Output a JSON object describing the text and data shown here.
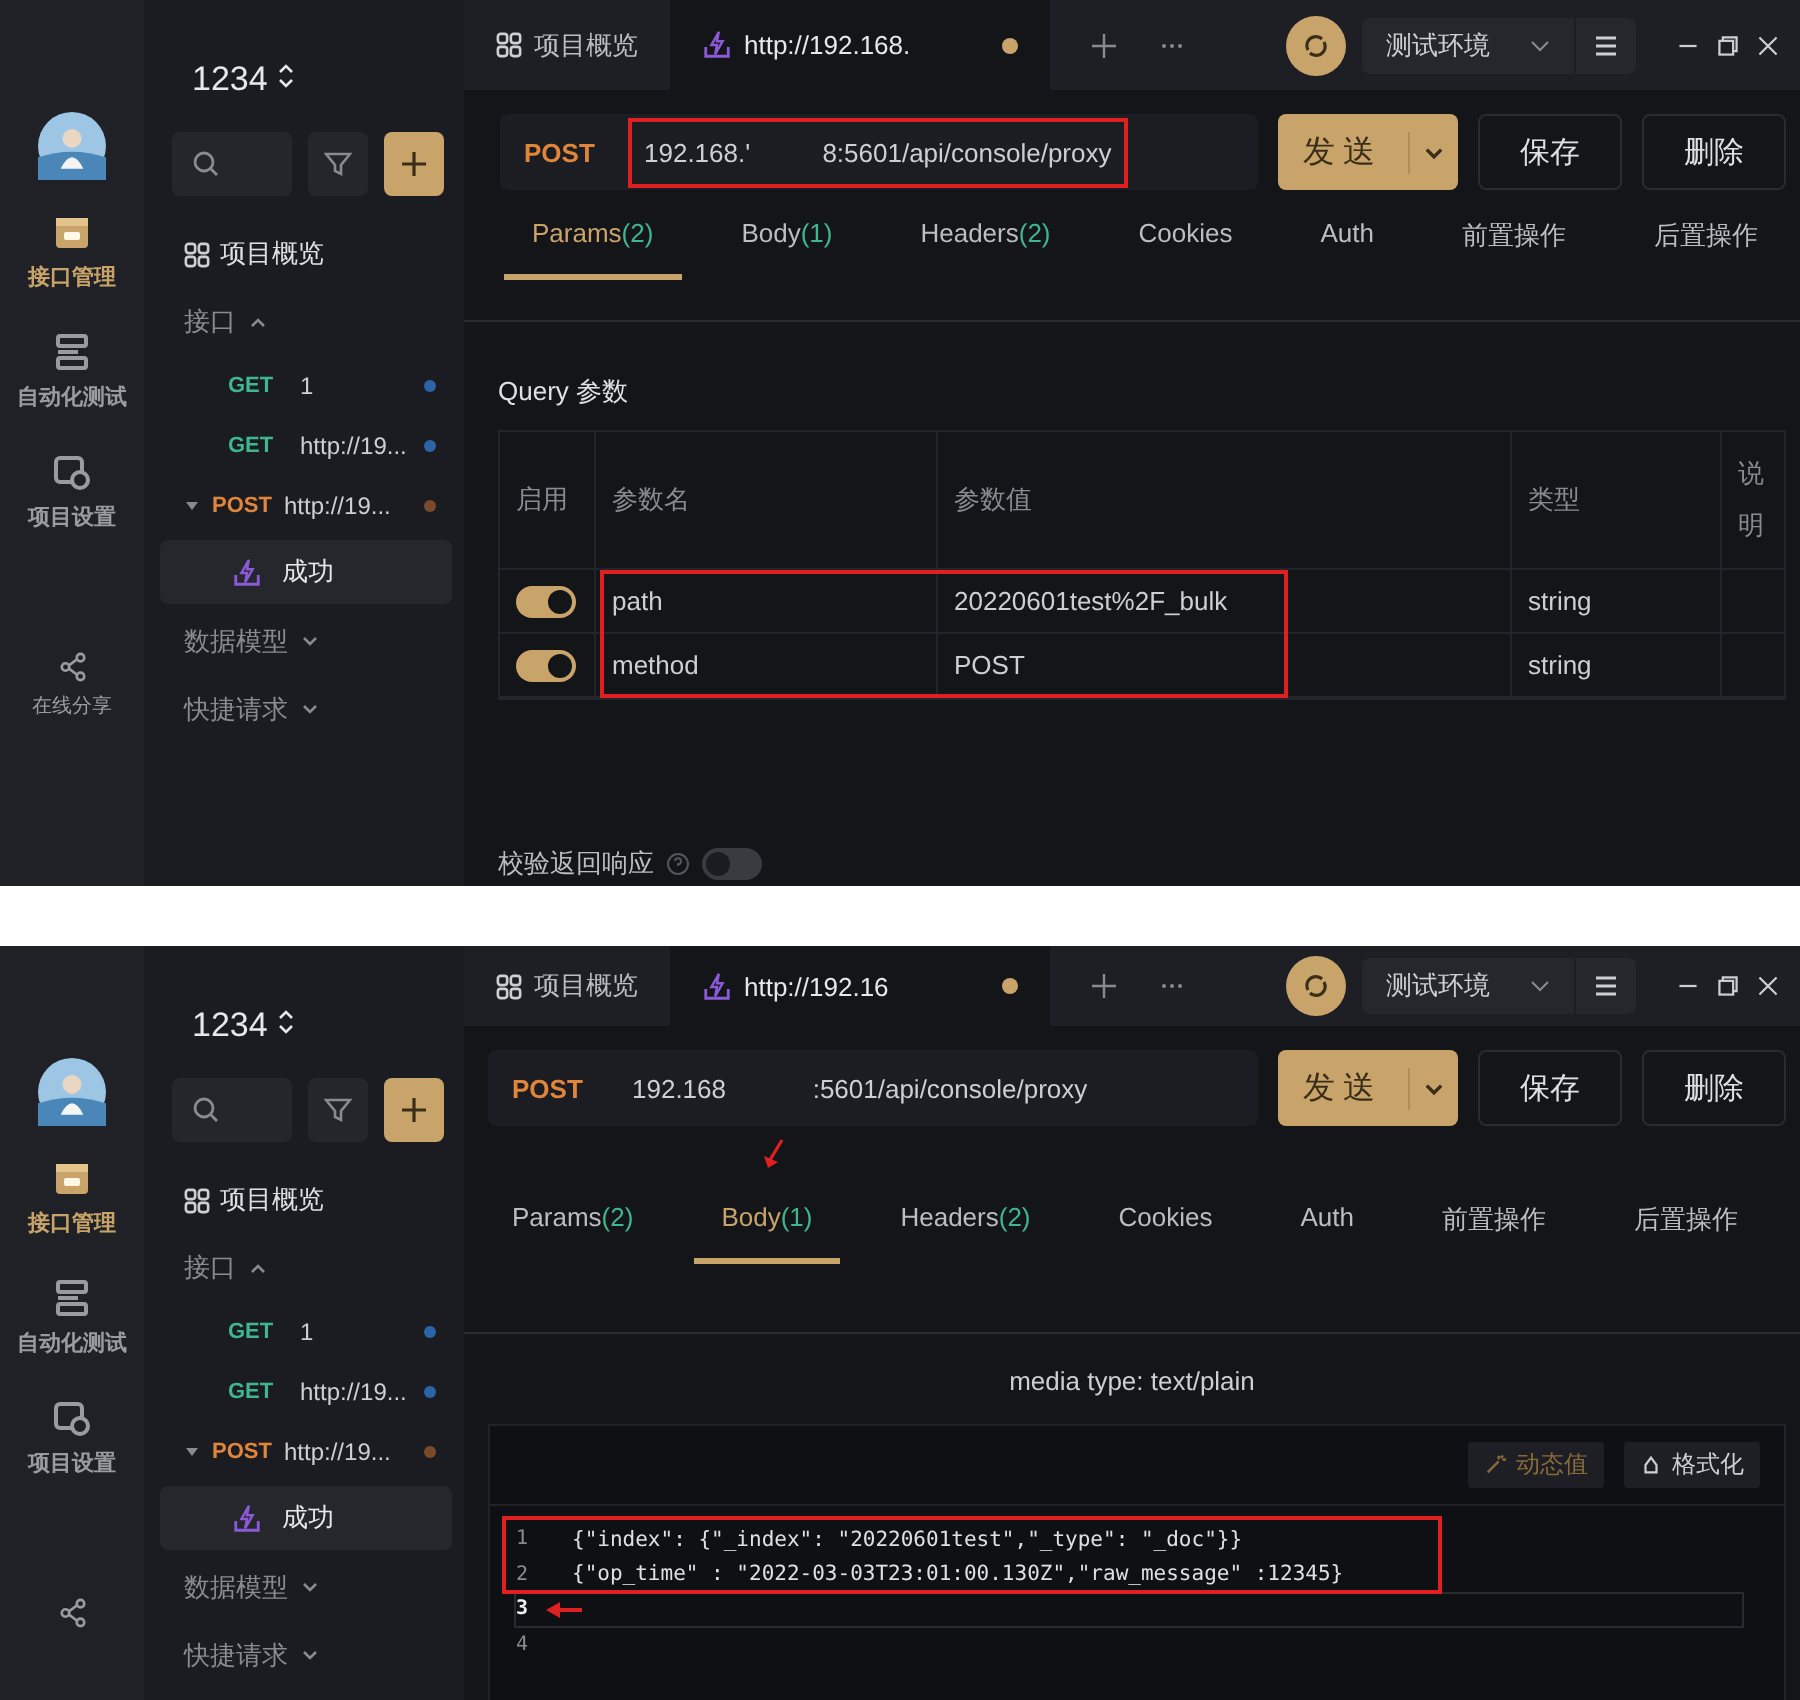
{
  "panels": [
    {
      "kind": "params",
      "project": "1234",
      "rail": [
        {
          "label": "接口管理",
          "kind": "folder",
          "selected": true
        },
        {
          "label": "自动化测试",
          "kind": "stack",
          "selected": false
        },
        {
          "label": "项目设置",
          "kind": "settings",
          "selected": false
        },
        {
          "label": "在线分享",
          "kind": "share",
          "selected": false
        }
      ],
      "sidebar": {
        "overview": "项目概览",
        "groups": [
          {
            "label": "接口",
            "expanded": true,
            "items": [
              {
                "method": "GET",
                "kind": "get",
                "name": "1",
                "color": "#2c64a8"
              },
              {
                "method": "GET",
                "kind": "get",
                "name": "http://19...",
                "color": "#2c64a8"
              },
              {
                "method": "POST",
                "kind": "post",
                "name": "http://19...",
                "color": "#7a4a2a",
                "expanded": true,
                "children": [
                  {
                    "name": "成功",
                    "selected": true
                  }
                ]
              }
            ]
          },
          {
            "label": "数据模型",
            "expanded": false
          },
          {
            "label": "快捷请求",
            "expanded": false
          }
        ]
      },
      "tabs": [
        {
          "label": "项目概览",
          "kind": "overview",
          "selected": false
        },
        {
          "label": "http://192.168.",
          "kind": "request",
          "selected": true,
          "unsaved": true
        }
      ],
      "environment": "测试环境",
      "request": {
        "method": "POST",
        "url": "192.168.'          8:5601/api/console/proxy",
        "highlighted": true
      },
      "send": "发送",
      "save": "保存",
      "delete": "删除",
      "request_tabs": [
        {
          "label": "Params",
          "count": "(2)",
          "selected": true,
          "marked": false
        },
        {
          "label": "Body",
          "count": "(1)",
          "selected": false,
          "marked": false
        },
        {
          "label": "Headers",
          "count": "(2)",
          "selected": false,
          "marked": false
        },
        {
          "label": "Cookies",
          "selected": false,
          "marked": false
        },
        {
          "label": "Auth",
          "selected": false,
          "marked": false
        },
        {
          "label": "前置操作",
          "selected": false,
          "marked": false
        },
        {
          "label": "后置操作",
          "selected": false,
          "marked": false
        }
      ],
      "params": {
        "title": "Query 参数",
        "columns": [
          "启用",
          "参数名",
          "参数值",
          "类型",
          "说明"
        ],
        "highlighted": true,
        "rows": [
          {
            "enabled": true,
            "name": "path",
            "value": "20220601test%2F_bulk",
            "type": "string"
          },
          {
            "enabled": true,
            "name": "method",
            "value": "POST",
            "type": "string"
          }
        ],
        "validate": {
          "label": "校验返回响应",
          "on": false
        }
      }
    },
    {
      "kind": "body",
      "project": "1234",
      "rail": [
        {
          "label": "接口管理",
          "kind": "folder",
          "selected": true
        },
        {
          "label": "自动化测试",
          "kind": "stack",
          "selected": false
        },
        {
          "label": "项目设置",
          "kind": "settings",
          "selected": false
        },
        {
          "kind": "share",
          "selected": false
        }
      ],
      "sidebar": {
        "overview": "项目概览",
        "groups": [
          {
            "label": "接口",
            "expanded": true,
            "items": [
              {
                "method": "GET",
                "kind": "get",
                "name": "1",
                "color": "#2c64a8"
              },
              {
                "method": "GET",
                "kind": "get",
                "name": "http://19...",
                "color": "#2c64a8"
              },
              {
                "method": "POST",
                "kind": "post",
                "name": "http://19...",
                "color": "#7a4a2a",
                "expanded": true,
                "children": [
                  {
                    "name": "成功",
                    "selected": true
                  }
                ]
              }
            ]
          },
          {
            "label": "数据模型",
            "expanded": false
          },
          {
            "label": "快捷请求",
            "expanded": false
          }
        ]
      },
      "tabs": [
        {
          "label": "项目概览",
          "kind": "overview",
          "selected": false
        },
        {
          "label": "http://192.16",
          "kind": "request",
          "selected": true,
          "unsaved": true
        }
      ],
      "environment": "测试环境",
      "request": {
        "method": "POST",
        "url": "192.168            :5601/api/console/proxy",
        "highlighted": false
      },
      "send": "发送",
      "save": "保存",
      "delete": "删除",
      "request_tabs": [
        {
          "label": "Params",
          "count": "(2)",
          "selected": false,
          "marked": false
        },
        {
          "label": "Body",
          "count": "(1)",
          "selected": true,
          "marked": true
        },
        {
          "label": "Headers",
          "count": "(2)",
          "selected": false,
          "marked": false
        },
        {
          "label": "Cookies",
          "selected": false,
          "marked": false
        },
        {
          "label": "Auth",
          "selected": false,
          "marked": false
        },
        {
          "label": "前置操作",
          "selected": false,
          "marked": false
        },
        {
          "label": "后置操作",
          "selected": false,
          "marked": false
        }
      ],
      "body": {
        "media_type": "media type: text/plain",
        "tools": [
          {
            "label": "动态值",
            "kind": "dynamic"
          },
          {
            "label": "格式化",
            "kind": "format"
          }
        ],
        "code_highlighted": true,
        "cursor_marked": true,
        "lines": [
          {
            "number": "1",
            "code": "{\"index\": {\"_index\": \"20220601test\",\"_type\": \"_doc\"}}",
            "current": false
          },
          {
            "number": "2",
            "code": "{\"op_time\" : \"2022-03-03T23:01:00.130Z\",\"raw_message\" :12345}",
            "current": false
          },
          {
            "number": "3",
            "current": true
          },
          {
            "number": "4",
            "current": false
          }
        ]
      }
    }
  ]
}
